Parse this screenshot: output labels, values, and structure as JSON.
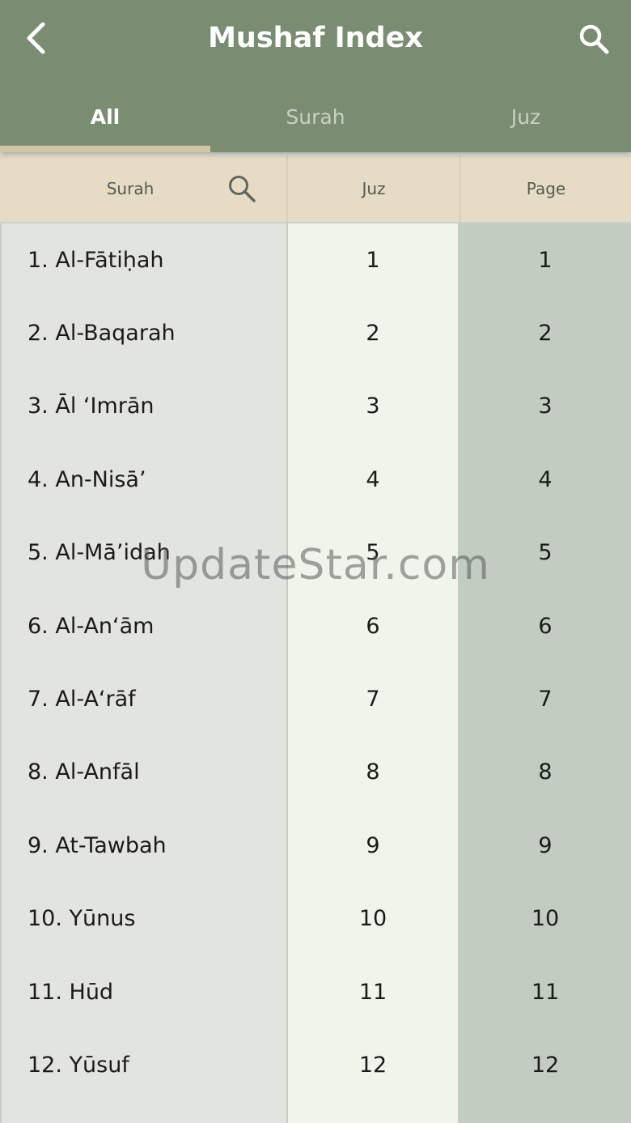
{
  "header": {
    "title": "Mushaf Index",
    "icons": {
      "back": "chevron-left-icon",
      "search": "search-icon"
    }
  },
  "tabs": [
    {
      "label": "All",
      "active": true
    },
    {
      "label": "Surah",
      "active": false
    },
    {
      "label": "Juz",
      "active": false
    }
  ],
  "columns": {
    "surah": "Surah",
    "juz": "Juz",
    "page": "Page"
  },
  "rows": [
    {
      "surah": "1. Al-Fātiḥah",
      "juz": "1",
      "page": "1"
    },
    {
      "surah": "2. Al-Baqarah",
      "juz": "2",
      "page": "2"
    },
    {
      "surah": "3. Āl ‘Imrān",
      "juz": "3",
      "page": "3"
    },
    {
      "surah": "4. An-Nisā’",
      "juz": "4",
      "page": "4"
    },
    {
      "surah": "5. Al-Mā’idah",
      "juz": "5",
      "page": "5"
    },
    {
      "surah": "6. Al-An‘ām",
      "juz": "6",
      "page": "6"
    },
    {
      "surah": "7. Al-A‘rāf",
      "juz": "7",
      "page": "7"
    },
    {
      "surah": "8. Al-Anfāl",
      "juz": "8",
      "page": "8"
    },
    {
      "surah": "9. At-Tawbah",
      "juz": "9",
      "page": "9"
    },
    {
      "surah": "10. Yūnus",
      "juz": "10",
      "page": "10"
    },
    {
      "surah": "11. Hūd",
      "juz": "11",
      "page": "11"
    },
    {
      "surah": "12. Yūsuf",
      "juz": "12",
      "page": "12"
    }
  ],
  "watermark": "UpdateStar.com",
  "colors": {
    "topbar": "#7a8c72",
    "tab_indicator": "#d2c6a5",
    "header_row": "#e6dcc6",
    "surah_col": "#e1e4df",
    "juz_col": "#eff5ea",
    "page_col": "#c3ccc0"
  }
}
